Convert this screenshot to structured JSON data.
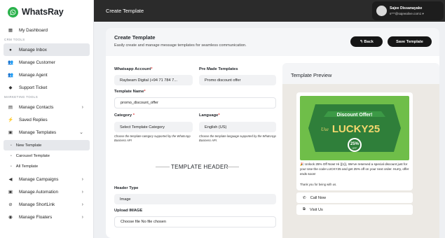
{
  "brand": {
    "name": "WhatsRay"
  },
  "sidebar": {
    "items": [
      {
        "label": "My Dashboard",
        "icon": "grid-icon"
      },
      {
        "section": "CRM TOOLS"
      },
      {
        "label": "Manage Inbox",
        "icon": "chat-icon",
        "active": true
      },
      {
        "label": "Manage Customer",
        "icon": "users-icon"
      },
      {
        "label": "Manage Agent",
        "icon": "agents-icon"
      },
      {
        "label": "Support Ticket",
        "icon": "ticket-icon"
      },
      {
        "section": "MARKETING TOOLS"
      },
      {
        "label": "Manage Contacts",
        "icon": "contacts-icon",
        "chevron": "›"
      },
      {
        "label": "Saved Replies",
        "icon": "bolt-icon"
      },
      {
        "label": "Manage Templates",
        "icon": "template-icon",
        "chevron": "⌄"
      }
    ],
    "subitems": [
      {
        "label": "New Template",
        "active": true
      },
      {
        "label": "Carousel Template"
      },
      {
        "label": "All Template"
      }
    ],
    "items_after": [
      {
        "label": "Manage Campaigns",
        "icon": "megaphone-icon",
        "chevron": "›"
      },
      {
        "label": "Manage Automation",
        "icon": "automation-icon",
        "chevron": "›"
      },
      {
        "label": "Manage ShortLink",
        "icon": "link-icon",
        "chevron": "›"
      },
      {
        "label": "Manage Floaters",
        "icon": "floater-icon",
        "chevron": "›"
      }
    ]
  },
  "header": {
    "title": "Create Template",
    "user_name": "Sajee Dissanayake",
    "user_email": "s***@sajeealive.com1 ▾"
  },
  "page": {
    "title": "Create Template",
    "description": "Easily create and manage message templates for seamless communication.",
    "back_label": "↰ Back",
    "save_label": "Save Template"
  },
  "form": {
    "account_label": "Whatsapp Account",
    "account_value": "Raybeam Digital (+94 71 784 7...",
    "premade_label": "Pre Made Templates",
    "premade_value": "Promo discount offer",
    "name_label": "Template Name",
    "name_value": "promo_discount_offer",
    "category_label": "Category",
    "category_value": "Select Template Category",
    "category_help": "Choose the template category supported by the WhatsApp Business API",
    "language_label": "Language",
    "language_value": "English (US)",
    "language_help": "Choose the template language supported by the WhatsApp Business API.",
    "section_title": "TEMPLATE HEADER",
    "header_type_label": "Header Type",
    "header_type_value": "Image",
    "upload_label": "Upload IMAGE",
    "upload_value": "Choose file No file chosen",
    "required_mark": "*"
  },
  "preview": {
    "title": "Template Preview",
    "promo_banner": "Discount Offer!",
    "promo_prefix": "Use",
    "promo_code": "LUCKY25",
    "promo_badge_pct": "25%",
    "promo_badge_off": "OFF",
    "message": "🎉 Unlock 25% Off Now! Hi {{1}}, We've reserved a special discount just for you! Use the code LUCKY25 and get 25% off on your next order. Hurry, offer ends soon!",
    "thanks": "Thank you for being with us.",
    "cta_call": "Call Now",
    "cta_visit": "Visit Us"
  },
  "colors": {
    "brand_green": "#2bb24c",
    "promo_green": "#6fbe49",
    "dark": "#161616"
  }
}
